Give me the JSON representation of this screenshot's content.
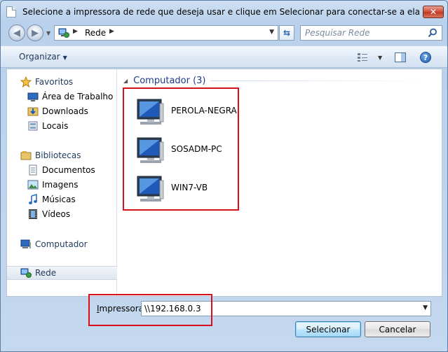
{
  "window": {
    "title": "Selecione a impressora de rede que deseja usar e clique em Selecionar para conectar-se a ela",
    "close_label": "✕"
  },
  "address": {
    "crumb": "Rede",
    "search_placeholder": "Pesquisar Rede"
  },
  "toolbar": {
    "organize_label": "Organizar"
  },
  "nav": {
    "favorites": {
      "label": "Favoritos",
      "items": [
        {
          "label": "Área de Trabalho"
        },
        {
          "label": "Downloads"
        },
        {
          "label": "Locais"
        }
      ]
    },
    "libraries": {
      "label": "Bibliotecas",
      "items": [
        {
          "label": "Documentos"
        },
        {
          "label": "Imagens"
        },
        {
          "label": "Músicas"
        },
        {
          "label": "Vídeos"
        }
      ]
    },
    "computer": {
      "label": "Computador"
    },
    "network": {
      "label": "Rede"
    }
  },
  "files": {
    "group_title": "Computador (3)",
    "computers": [
      {
        "name": "PEROLA-NEGRA"
      },
      {
        "name": "SOSADM-PC"
      },
      {
        "name": "WIN7-VB"
      }
    ]
  },
  "bottom": {
    "printer_label_first": "I",
    "printer_label_rest": "mpressora",
    "printer_value": "\\\\192.168.0.3",
    "select_button": "Selecionar",
    "cancel_button": "Cancelar"
  },
  "colors": {
    "highlight_box": "#d6111b",
    "group_header": "#1e3b8a"
  }
}
